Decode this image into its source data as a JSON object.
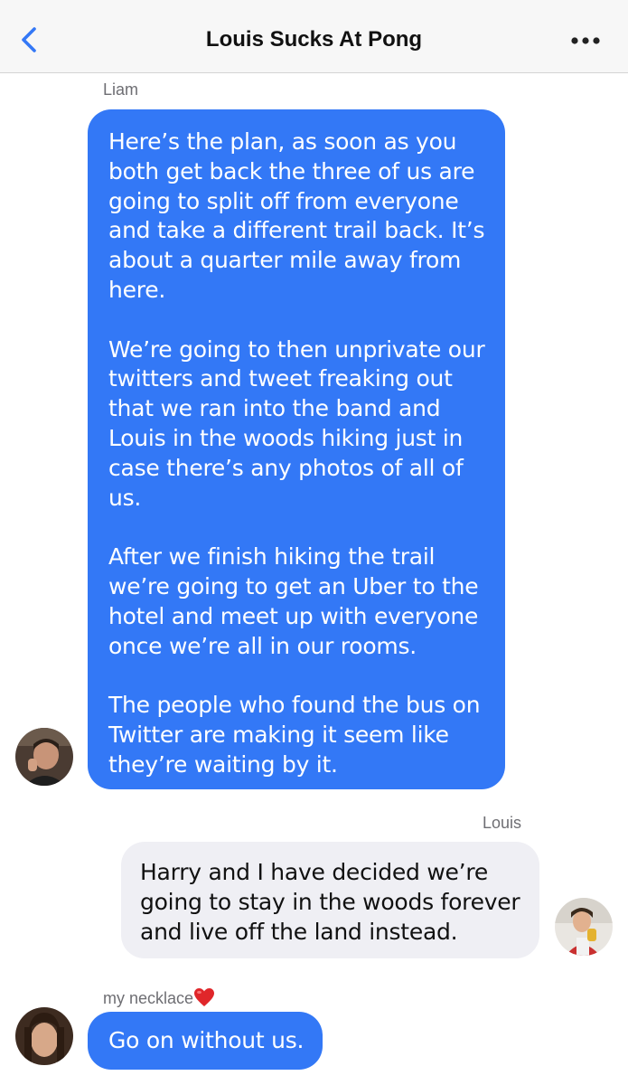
{
  "header": {
    "title": "Louis Sucks At Pong",
    "accent_color": "#3478f6"
  },
  "messages": [
    {
      "sender": "Liam",
      "text": "Here’s the plan, as soon as you both get back the three of us are going to split off from everyone and take a different trail back. It’s about a quarter mile away from here.\n\nWe’re going to then unprivate our twitters and tweet freaking out that we ran into the band and Louis in the woods hiking just in case there’s any photos of all of us.\n\nAfter we finish hiking the trail we’re going to get an Uber to the hotel and meet up with everyone once we’re all in our rooms.\n\nThe people who found the bus on Twitter are making it seem like they’re waiting by it.",
      "bubble_color": "#3378f6"
    },
    {
      "sender": "Louis",
      "text": "Harry and I have decided we’re going to stay in the woods forever and live off the land instead.",
      "bubble_color": "#efeff4"
    },
    {
      "sender": "my necklace",
      "sender_emoji": "heart-emoji",
      "text": "Go on without us.",
      "bubble_color": "#3378f6"
    }
  ],
  "icons": {
    "back": "chevron-left-icon",
    "more": "ellipsis-icon"
  }
}
